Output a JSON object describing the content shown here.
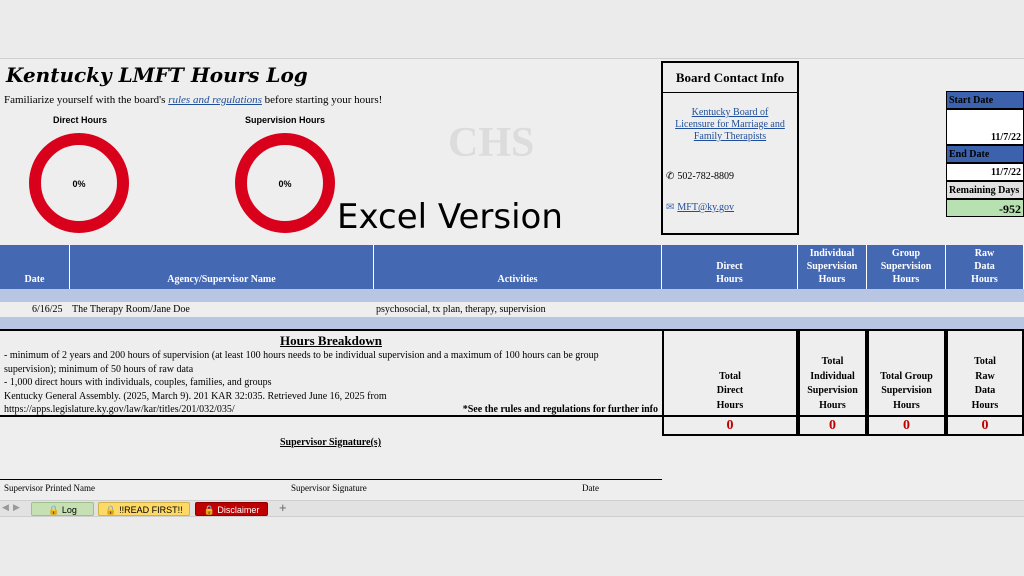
{
  "sheet": {
    "title": "Kentucky LMFT Hours Log",
    "intro_before": "Familiarize yourself with the board's ",
    "intro_link": "rules and regulations",
    "intro_after": " before starting your hours!",
    "donuts": [
      {
        "label": "Direct Hours",
        "value": "0%",
        "fraction": 0
      },
      {
        "label": "Supervision Hours",
        "value": "0%",
        "fraction": 0
      }
    ],
    "watermark": "CHS",
    "overlay_text": "Excel Version"
  },
  "contact": {
    "header": "Board Contact Info",
    "board_link": "Kentucky Board of Licensure for Marriage and Family Therapists",
    "phone": "502-782-8809",
    "email": "MFT@ky.gov"
  },
  "dates": {
    "start_label": "Start Date",
    "start_value": "11/7/22",
    "end_label": "End Date",
    "end_value": "11/7/22",
    "remaining_label": "Remaining Days",
    "remaining_value": "-952"
  },
  "table": {
    "headers": {
      "date": "Date",
      "agency": "Agency/Supervisor Name",
      "activities": "Activities",
      "direct": "Direct Hours",
      "individual": "Individual Supervision Hours",
      "group": "Group Supervision Hours",
      "raw": "Raw Data Hours"
    },
    "rows": [
      {
        "date": "6/16/25",
        "agency": "The Therapy Room/Jane Doe",
        "activities": "psychosocial, tx plan, therapy, supervision"
      }
    ]
  },
  "breakdown": {
    "title": "Hours Breakdown",
    "lines": [
      "- minimum of 2 years and 200 hours of supervision (at least 100 hours needs to be individual supervision and a maximum of 100 hours can be group",
      "supervision); minimum of 50 hours of raw data",
      "- 1,000 direct hours with individuals, couples, families, and groups",
      "Kentucky General Assembly. (2025, March 9). 201 KAR 32:035. Retrieved June 16, 2025 from",
      "https://apps.legislature.ky.gov/law/kar/titles/201/032/035/"
    ],
    "note": "*See the rules and regulations for further info"
  },
  "totals": {
    "direct_label": "Total Direct Hours",
    "individual_label": "Total Individual Supervision Hours",
    "group_label": "Total Group Supervision Hours",
    "raw_label": "Total Raw Data Hours",
    "direct": "0",
    "individual": "0",
    "group": "0",
    "raw": "0"
  },
  "signature": {
    "header": "Supervisor Signature(s)",
    "printed_name": "Supervisor Printed Name",
    "signature": "Supervisor Signature",
    "date": "Date"
  },
  "tabs": [
    {
      "label": "Log",
      "color": "#c6e0b4"
    },
    {
      "label": "!!READ FIRST!!",
      "color": "#ffd966"
    },
    {
      "label": "Disclaimer",
      "color": "#c00000"
    }
  ],
  "tabbar": {
    "add": "+",
    "prev": "◀",
    "next": "▶"
  }
}
